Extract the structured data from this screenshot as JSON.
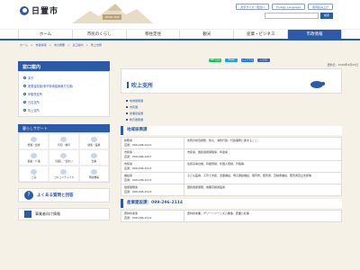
{
  "header": {
    "city_name": "日置市",
    "sub_label": "HIOKI TOP",
    "util_buttons": [
      "文字サイズ・色合い",
      "Foreign Language",
      "音声読み上げ"
    ],
    "search_placeholder": "",
    "search_button": "検索"
  },
  "nav": [
    "ホーム",
    "市民のくらし",
    "移住定住",
    "観光",
    "産業・ビジネス",
    "市政情報"
  ],
  "breadcrumb": [
    "ホーム",
    "市政情報",
    "市の概要",
    "窓口案内",
    "吹上支所"
  ],
  "sidebar": {
    "title": "窓口案内",
    "links": [
      "本庁",
      "産業建設部(東市街地建築局方位置)",
      "伊集院支所",
      "日吉支所",
      "吹上支所"
    ],
    "life_title": "暮らしサポート",
    "life_items": [
      "妊娠・出産",
      "育児・教育",
      "健康・医療",
      "福祉・介護",
      "引越し・住まい",
      "仕事",
      "ごみ",
      "コミュニティバス",
      "申請書等"
    ],
    "faq": "よくある質問と回答",
    "jigyo": "事業者向け情報"
  },
  "main": {
    "share": [
      "LINEで送る",
      "Tweet",
      "シェアする",
      "いいね"
    ],
    "date": "更新日：2020年3月25日",
    "title": "吹上支所",
    "anchors": [
      "地域振興課",
      "市民課",
      "産業建設課",
      "教育振興課"
    ],
    "section1": "地域振興課",
    "rows": [
      {
        "name": "総務係",
        "phone": "直通：099-296-2112",
        "desc": "支所の総合調整、防災、消防行政、行政事務に関すること"
      },
      {
        "name": "市民係",
        "phone": "直通：099-296-2297",
        "desc": "市民係、国民健康保険係、年金係"
      },
      {
        "name": "市民係",
        "phone": "直通：099-296-2113",
        "desc": "住民基本台帳、印鑑登録、外国人登録、戸籍等"
      },
      {
        "name": "福祉係",
        "phone": "直通：099-296-2113",
        "desc": "子ども医療、子育て支援、児童福祉、母子寡婦福祉、保育所、障害者、高齢者福祉、障害者自立支援等"
      },
      {
        "name": "健康保険係",
        "phone": "直通：099-296-2113",
        "desc": "国民健康保険、後期高齢者医療"
      }
    ],
    "section2": "産業建設課：099-296-2114",
    "rows2": [
      {
        "name": "農林水産係",
        "phone": "直通：099-296-2114",
        "desc": "農林水産業、グリーンツーリズム推進、農業公社等"
      }
    ]
  },
  "colors": {
    "brand": "#2c5aa8",
    "background": "#f6f1e7"
  }
}
